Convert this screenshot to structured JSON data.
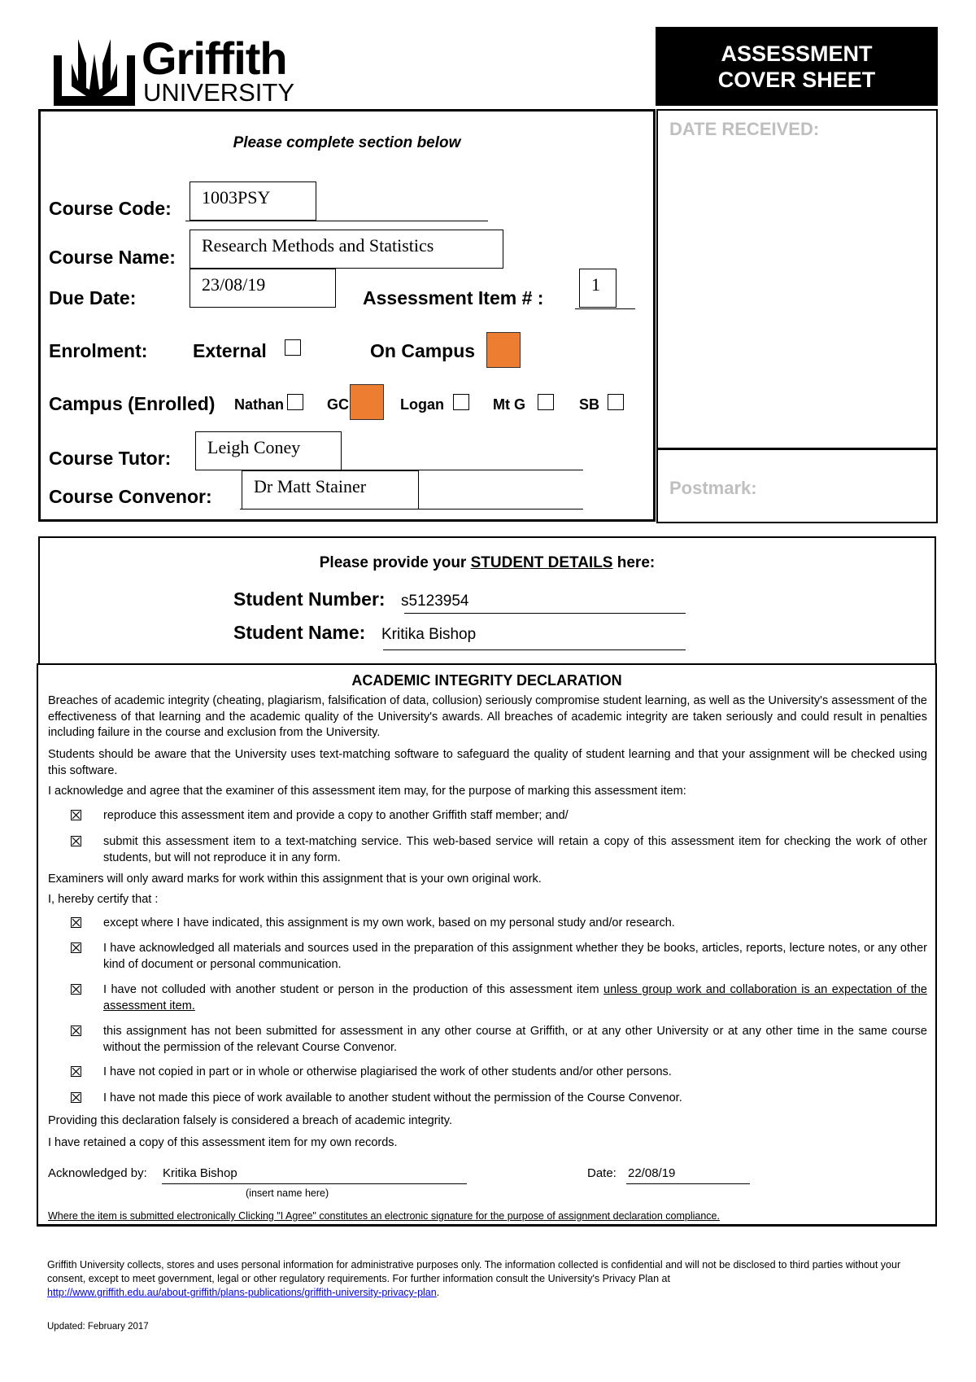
{
  "header": {
    "logo_word": "Griffith",
    "logo_sub": "UNIVERSITY",
    "title_line1": "ASSESSMENT",
    "title_line2": "COVER SHEET"
  },
  "office": {
    "date_received_label": "DATE RECEIVED:",
    "postmark_label": "Postmark:"
  },
  "course": {
    "section_hint": "Please complete section below",
    "course_code_label": "Course Code:",
    "course_code_value": "1003PSY",
    "course_name_label": "Course Name:",
    "course_name_value": "Research Methods and Statistics",
    "due_date_label": "Due Date:",
    "due_date_value": "23/08/19",
    "assessment_item_label": "Assessment Item # :",
    "assessment_item_value": "1",
    "enrolment_label": "Enrolment:",
    "enrolment_options": [
      {
        "label": "External",
        "checked": false
      },
      {
        "label": "On Campus",
        "checked": true
      }
    ],
    "campus_label": "Campus (Enrolled)",
    "campus_options": [
      {
        "label": "Nathan",
        "checked": false
      },
      {
        "label": "GC",
        "checked": true
      },
      {
        "label": "Logan",
        "checked": false
      },
      {
        "label": "Mt G",
        "checked": false
      },
      {
        "label": "SB",
        "checked": false
      }
    ],
    "checked_color": "#ED7D31",
    "tutor_label": "Course Tutor:",
    "tutor_value": "Leigh Coney",
    "convenor_label": "Course Convenor:",
    "convenor_value": "Dr Matt Stainer"
  },
  "student": {
    "hint_prefix": "Please provide your ",
    "hint_emphasis": "STUDENT DETAILS",
    "hint_suffix": " here:",
    "number_label": "Student Number:",
    "number_value": "s5123954",
    "name_label": "Student Name:",
    "name_value": "Kritika Bishop"
  },
  "declaration": {
    "title": "ACADEMIC INTEGRITY DECLARATION",
    "para1": "Breaches of academic integrity (cheating, plagiarism, falsification of data, collusion) seriously compromise student learning, as well as the University's assessment of the effectiveness of that learning and the academic quality of the University's awards.  All breaches of academic integrity are taken seriously and could result in penalties including failure in the course and exclusion from the University.",
    "para2": "Students should be aware that the University uses text-matching software to safeguard the quality of student learning and that your assignment will be checked using this software.",
    "para3": "I acknowledge and agree that the examiner of this assessment item may, for the purpose of marking this assessment item:",
    "agree_items": [
      {
        "text": "reproduce this assessment item and provide a copy to another Griffith staff member; and/",
        "checked": true
      },
      {
        "text": "submit this assessment item to a text-matching service. This web-based service will retain a copy of this assessment item for checking the work of other students, but will not reproduce it in any form.",
        "checked": true
      }
    ],
    "para4": "Examiners will only award marks for work within this assignment that is your own original work.",
    "para5": "I, hereby certify that :",
    "certify_items": [
      {
        "text": "except where I have indicated, this assignment is my own work, based on my personal study and/or research.",
        "checked": true
      },
      {
        "text": "I have acknowledged all materials and sources used in the preparation of this assignment whether they be books, articles, reports, lecture notes, or any other kind of document or personal communication.",
        "checked": true
      },
      {
        "text": "I have not colluded with another student or person in the production of this assessment item ",
        "underlined_suffix": "unless group work and collaboration is an expectation of the assessment item.",
        "checked": true
      },
      {
        "text": "this assignment has not been submitted for assessment in any other course at Griffith, or at any other University or at any other time in the same course without the permission of the relevant Course Convenor.",
        "checked": true
      },
      {
        "text": "I have not copied in part or in whole or otherwise plagiarised the work of other students and/or other persons.",
        "checked": true
      },
      {
        "text": "I have not made this piece of work available to another student without the permission of the Course Convenor.",
        "checked": true
      }
    ],
    "para6": "Providing this declaration falsely is considered a breach of academic integrity.",
    "para7": "I have retained a copy of this assessment item for my own records.",
    "ack_label": "Acknowledged by:",
    "ack_value": "Kritika Bishop",
    "ack_hint": "(insert name here)",
    "date_label": "Date:",
    "date_value": "22/08/19",
    "esign_note": "Where the item is submitted electronically Clicking \"I Agree\" constitutes an electronic signature for the purpose of assignment declaration compliance."
  },
  "footer": {
    "privacy_text": "Griffith University collects, stores and uses personal information for administrative purposes only.  The information collected is confidential and will not be disclosed to third parties without your consent, except to meet government, legal or other regulatory requirements.  For further information consult the University's Privacy Plan at ",
    "privacy_link": "http://www.griffith.edu.au/about-griffith/plans-publications/griffith-university-privacy-plan",
    "privacy_end": ".",
    "updated": "Updated:  February 2017"
  }
}
